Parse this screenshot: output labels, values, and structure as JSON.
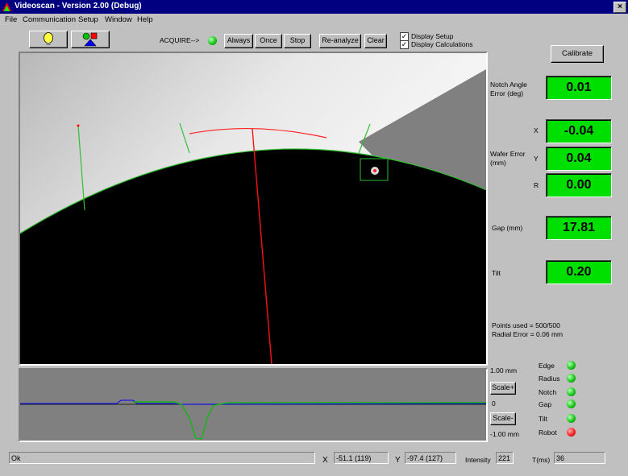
{
  "window": {
    "title": "Videoscan - Version 2.00 (Debug)"
  },
  "menu": [
    {
      "label": "File"
    },
    {
      "label": "Communication"
    },
    {
      "label": "Setup"
    },
    {
      "label": "Window"
    },
    {
      "label": "Help"
    }
  ],
  "toolbar": {
    "acquire_label": "ACQUIRE-->",
    "always": "Always",
    "once": "Once",
    "stop": "Stop",
    "reanalyze": "Re-analyze",
    "clear": "Clear",
    "display_setup": "Display Setup",
    "display_calculations": "Display Calculations",
    "display_setup_checked": true,
    "display_calculations_checked": true
  },
  "right_panel": {
    "calibrate": "Calibrate",
    "notch_angle_label": "Notch Angle Error (deg)",
    "notch_angle_value": "0.01",
    "wafer_error_label": "Wafer Error (mm)",
    "x_label": "X",
    "x_value": "-0.04",
    "y_label": "Y",
    "y_value": "0.04",
    "r_label": "R",
    "r_value": "0.00",
    "gap_label": "Gap (mm)",
    "gap_value": "17.81",
    "tilt_label": "Tilt",
    "tilt_value": "0.20",
    "points_used": "Points used = 500/500",
    "radial_error": "Radial Error = 0.06 mm"
  },
  "scale": {
    "top": "1.00 mm",
    "scale_plus": "Scale+",
    "zero": "0",
    "scale_minus": "Scale-",
    "bottom": "-1.00 mm"
  },
  "status_leds": [
    {
      "label": "Edge",
      "color": "green"
    },
    {
      "label": "Radius",
      "color": "green"
    },
    {
      "label": "Notch",
      "color": "green"
    },
    {
      "label": "Gap",
      "color": "green"
    },
    {
      "label": "Tilt",
      "color": "green"
    },
    {
      "label": "Robot",
      "color": "red"
    }
  ],
  "statusbar": {
    "message": "Ok",
    "x_label": "X",
    "x_value": "-51.1 (119)",
    "y_label": "Y",
    "y_value": "-97.4 (127)",
    "intensity_label": "Intensity",
    "intensity_value": "221",
    "tms_label": "T(ms)",
    "tms_value": "36"
  },
  "colors": {
    "readout_bg": "#00e000",
    "title_bg": "#000080",
    "profile_line": "#0000ff",
    "profile_trace": "#00c000"
  }
}
